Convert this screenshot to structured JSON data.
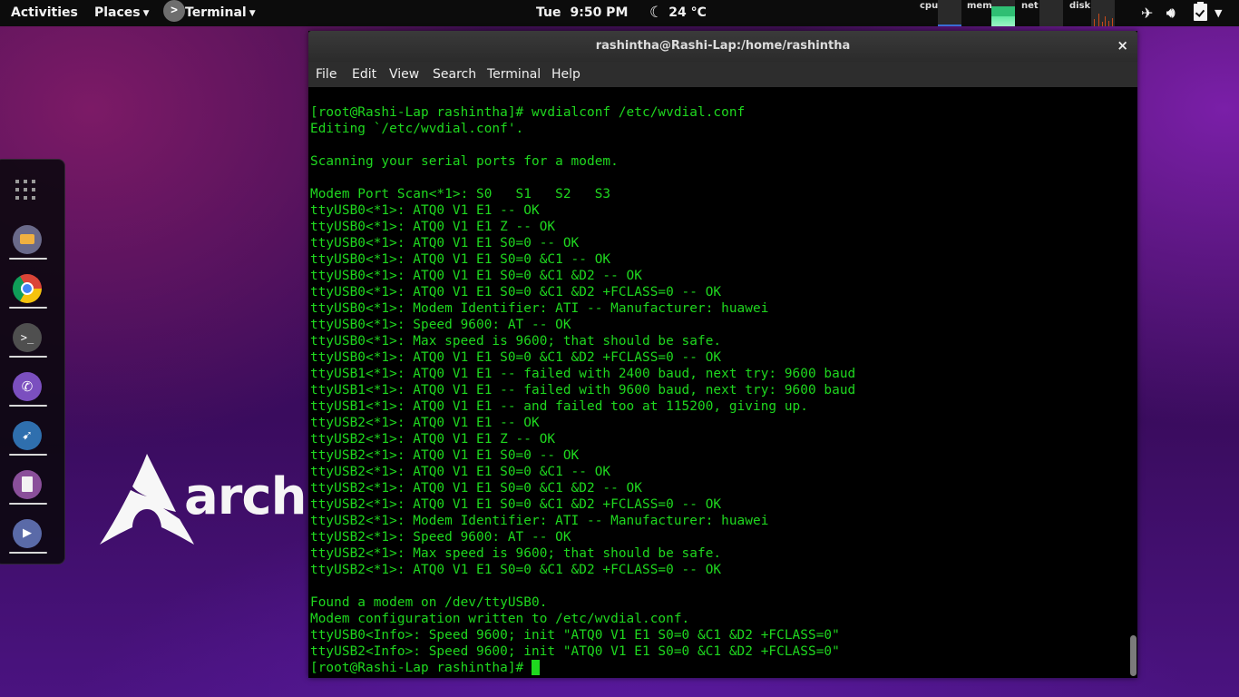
{
  "topbar": {
    "activities": "Activities",
    "places": "Places",
    "app_menu": "Terminal",
    "day": "Tue",
    "time": "9:50 PM",
    "weather_icon": "moon-cloud-icon",
    "temperature": "24 °C",
    "monitors": {
      "cpu": "cpu",
      "mem": "mem",
      "net": "net",
      "disk": "disk"
    },
    "tray_icons": [
      "airplane-mode-icon",
      "volume-icon",
      "battery-icon",
      "power-menu-icon"
    ]
  },
  "dock": {
    "items": [
      "show-applications-icon",
      "files-icon",
      "chrome-icon",
      "terminal-icon",
      "viber-icon",
      "network-monitor-icon",
      "text-editor-icon",
      "video-player-icon"
    ]
  },
  "wallpaper": {
    "logo_text": "archli"
  },
  "window": {
    "title": "rashintha@Rashi-Lap:/home/rashintha",
    "close": "×",
    "menu": [
      "File",
      "Edit",
      "View",
      "Search",
      "Terminal",
      "Help"
    ]
  },
  "terminal": {
    "lines": [
      "[root@Rashi-Lap rashintha]# wvdialconf /etc/wvdial.conf",
      "Editing `/etc/wvdial.conf'.",
      "",
      "Scanning your serial ports for a modem.",
      "",
      "Modem Port Scan<*1>: S0   S1   S2   S3",
      "ttyUSB0<*1>: ATQ0 V1 E1 -- OK",
      "ttyUSB0<*1>: ATQ0 V1 E1 Z -- OK",
      "ttyUSB0<*1>: ATQ0 V1 E1 S0=0 -- OK",
      "ttyUSB0<*1>: ATQ0 V1 E1 S0=0 &C1 -- OK",
      "ttyUSB0<*1>: ATQ0 V1 E1 S0=0 &C1 &D2 -- OK",
      "ttyUSB0<*1>: ATQ0 V1 E1 S0=0 &C1 &D2 +FCLASS=0 -- OK",
      "ttyUSB0<*1>: Modem Identifier: ATI -- Manufacturer: huawei",
      "ttyUSB0<*1>: Speed 9600: AT -- OK",
      "ttyUSB0<*1>: Max speed is 9600; that should be safe.",
      "ttyUSB0<*1>: ATQ0 V1 E1 S0=0 &C1 &D2 +FCLASS=0 -- OK",
      "ttyUSB1<*1>: ATQ0 V1 E1 -- failed with 2400 baud, next try: 9600 baud",
      "ttyUSB1<*1>: ATQ0 V1 E1 -- failed with 9600 baud, next try: 9600 baud",
      "ttyUSB1<*1>: ATQ0 V1 E1 -- and failed too at 115200, giving up.",
      "ttyUSB2<*1>: ATQ0 V1 E1 -- OK",
      "ttyUSB2<*1>: ATQ0 V1 E1 Z -- OK",
      "ttyUSB2<*1>: ATQ0 V1 E1 S0=0 -- OK",
      "ttyUSB2<*1>: ATQ0 V1 E1 S0=0 &C1 -- OK",
      "ttyUSB2<*1>: ATQ0 V1 E1 S0=0 &C1 &D2 -- OK",
      "ttyUSB2<*1>: ATQ0 V1 E1 S0=0 &C1 &D2 +FCLASS=0 -- OK",
      "ttyUSB2<*1>: Modem Identifier: ATI -- Manufacturer: huawei",
      "ttyUSB2<*1>: Speed 9600: AT -- OK",
      "ttyUSB2<*1>: Max speed is 9600; that should be safe.",
      "ttyUSB2<*1>: ATQ0 V1 E1 S0=0 &C1 &D2 +FCLASS=0 -- OK",
      "",
      "Found a modem on /dev/ttyUSB0.",
      "Modem configuration written to /etc/wvdial.conf.",
      "ttyUSB0<Info>: Speed 9600; init \"ATQ0 V1 E1 S0=0 &C1 &D2 +FCLASS=0\"",
      "ttyUSB2<Info>: Speed 9600; init \"ATQ0 V1 E1 S0=0 &C1 &D2 +FCLASS=0\""
    ],
    "prompt": "[root@Rashi-Lap rashintha]# "
  },
  "colors": {
    "terminal_text": "#1fd81f",
    "terminal_bg": "#000000",
    "topbar_bg": "#0c0c0c"
  }
}
